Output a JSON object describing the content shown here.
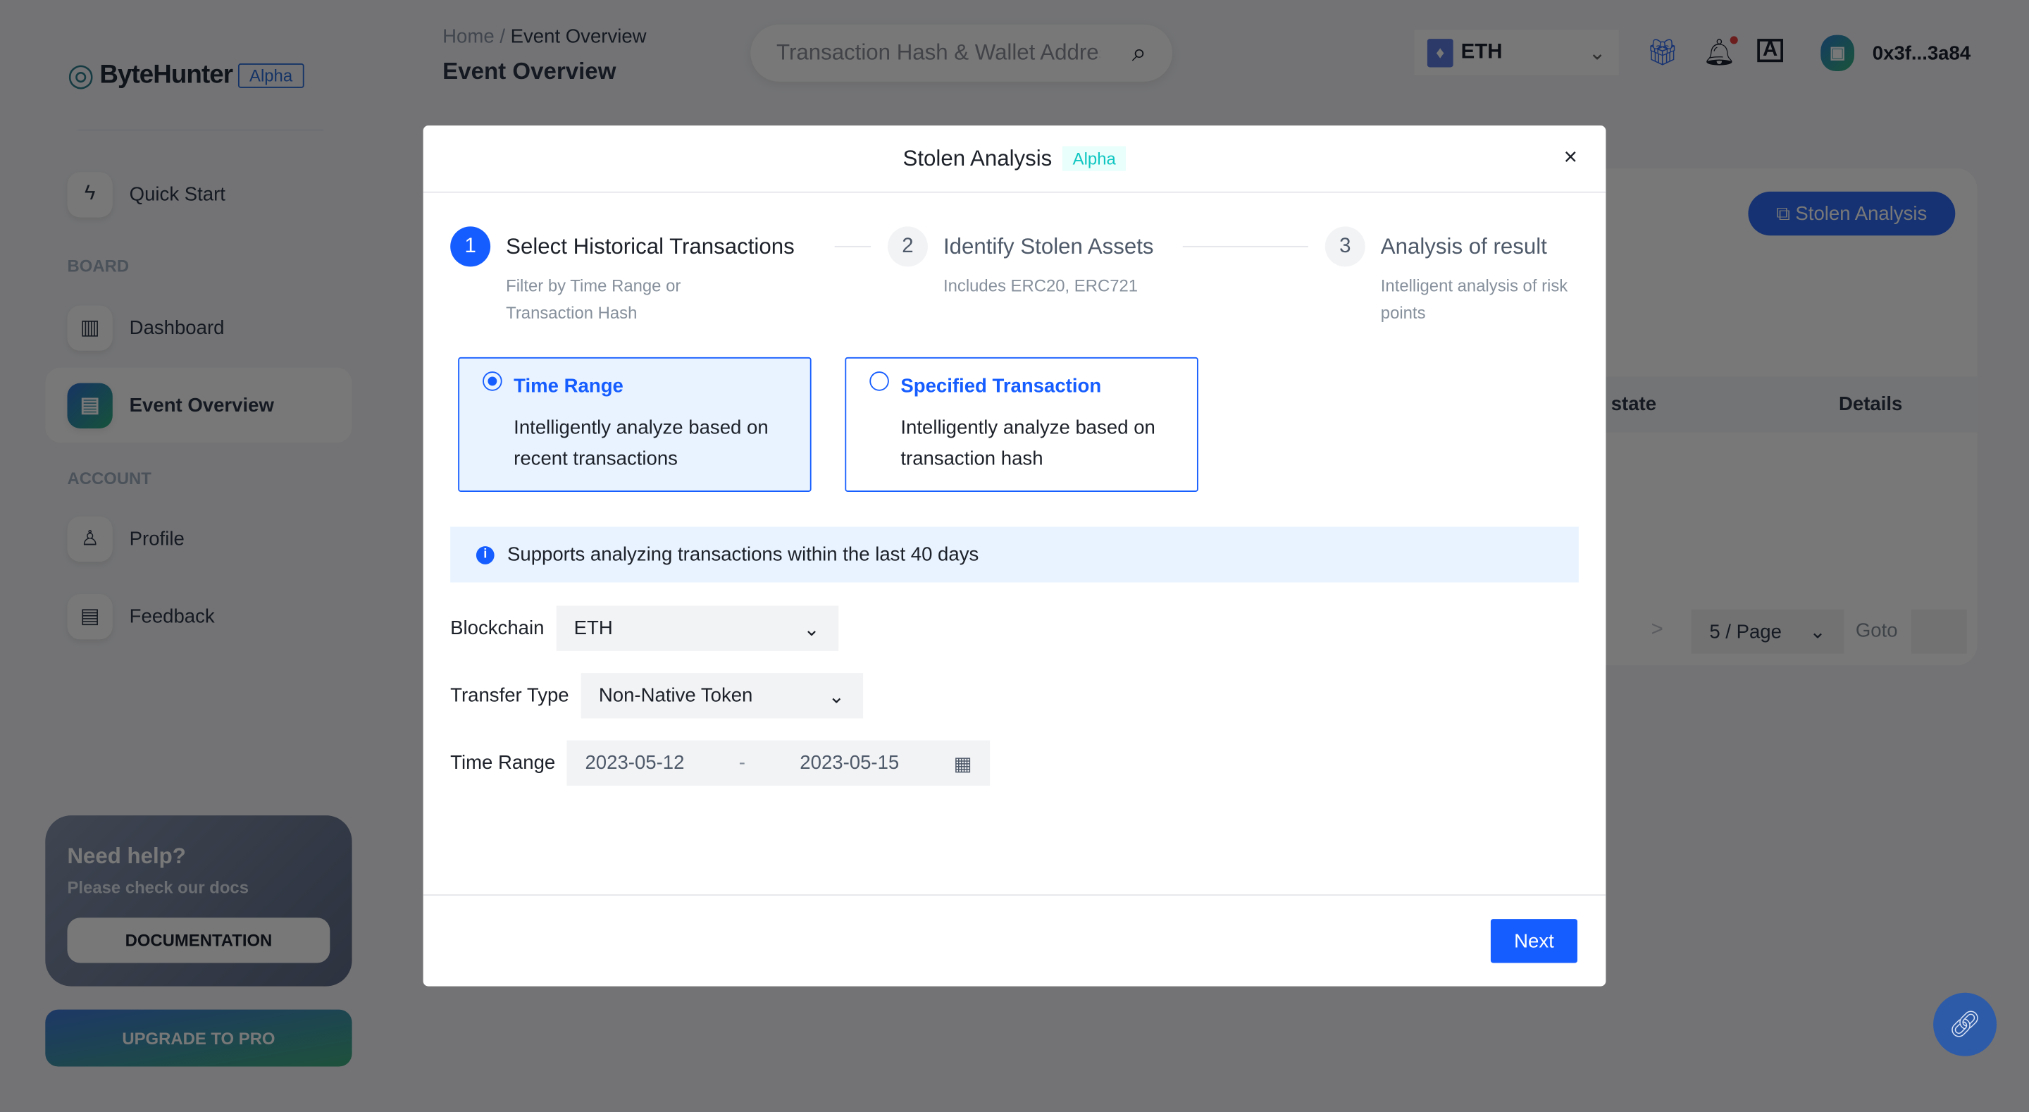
{
  "brand": {
    "name": "ByteHunter",
    "badge": "Alpha"
  },
  "sidebar": {
    "quick_start": "Quick Start",
    "board_label": "BOARD",
    "dashboard": "Dashboard",
    "event_overview": "Event Overview",
    "account_label": "ACCOUNT",
    "profile": "Profile",
    "feedback": "Feedback",
    "help": {
      "title": "Need help?",
      "subtitle": "Please check our docs",
      "button": "DOCUMENTATION"
    },
    "upgrade": "UPGRADE TO PRO"
  },
  "header": {
    "breadcrumb": {
      "home": "Home",
      "sep": "/",
      "current": "Event Overview"
    },
    "title": "Event Overview",
    "search_placeholder": "Transaction Hash & Wallet Address",
    "chain": "ETH",
    "wallet": "0x3f...3a84"
  },
  "background": {
    "stolen_button": "Stolen Analysis",
    "columns": [
      "state",
      "Details"
    ],
    "page_size": "5 / Page",
    "goto": "Goto",
    "next_arrow": ">"
  },
  "modal": {
    "title": "Stolen Analysis",
    "badge": "Alpha",
    "close": "×",
    "steps": [
      {
        "num": "1",
        "title": "Select Historical Transactions",
        "desc": "Filter by Time Range or Transaction Hash",
        "active": true
      },
      {
        "num": "2",
        "title": "Identify Stolen Assets",
        "desc": "Includes ERC20, ERC721",
        "active": false
      },
      {
        "num": "3",
        "title": "Analysis of result",
        "desc": "Intelligent analysis of risk points",
        "active": false
      }
    ],
    "options": [
      {
        "title": "Time Range",
        "desc": "Intelligently analyze based on recent transactions",
        "selected": true
      },
      {
        "title": "Specified Transaction",
        "desc": "Intelligently analyze based on transaction hash",
        "selected": false
      }
    ],
    "info": "Supports analyzing transactions within the last 40 days",
    "form": {
      "blockchain_label": "Blockchain",
      "blockchain_value": "ETH",
      "transfer_label": "Transfer Type",
      "transfer_value": "Non-Native Token",
      "time_label": "Time Range",
      "start_date": "2023-05-12",
      "date_sep": "-",
      "end_date": "2023-05-15"
    },
    "next": "Next"
  },
  "colors": {
    "primary": "#165dff",
    "selected_bg": "#e8f3ff",
    "overlay": "rgba(29,33,41,0.6)"
  }
}
